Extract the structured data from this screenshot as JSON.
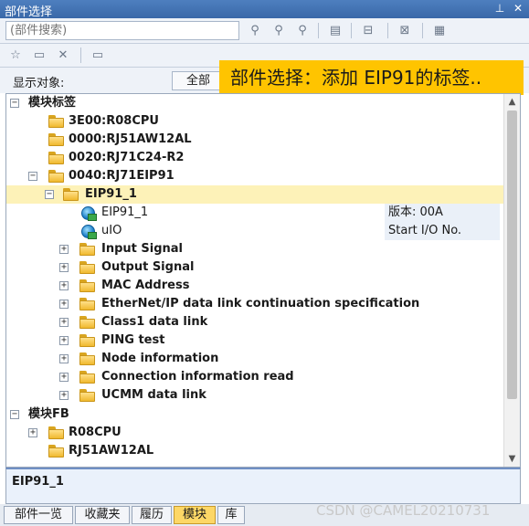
{
  "window": {
    "title": "部件选择"
  },
  "search": {
    "placeholder": "(部件搜索)"
  },
  "filter": {
    "label": "显示对象:",
    "value": "全部"
  },
  "callout": {
    "text": "部件选择：添加 EIP91的标签.."
  },
  "tree": {
    "root_module_tags": "模块标签",
    "items_module": [
      "3E00:R08CPU",
      "0000:RJ51AW12AL",
      "0020:RJ71C24-R2",
      "0040:RJ71EIP91"
    ],
    "eip_node": "EIP91_1",
    "eip_children": [
      {
        "label": "EIP91_1",
        "value": "版本: 00A"
      },
      {
        "label": "uIO",
        "value": "Start I/O No."
      }
    ],
    "eip_groups": [
      "Input Signal",
      "Output Signal",
      "MAC Address",
      "EtherNet/IP data link continuation specification",
      "Class1 data link",
      "PING test",
      "Node information",
      "Connection information read",
      "UCMM data link"
    ],
    "root_module_fb": "模块FB",
    "items_fb": [
      "R08CPU",
      "RJ51AW12AL"
    ]
  },
  "detail": {
    "name": "EIP91_1"
  },
  "tabs": [
    "部件一览",
    "收藏夹",
    "履历",
    "模块",
    "库"
  ],
  "active_tab": "模块",
  "watermark": "CSDN @CAMEL20210731"
}
